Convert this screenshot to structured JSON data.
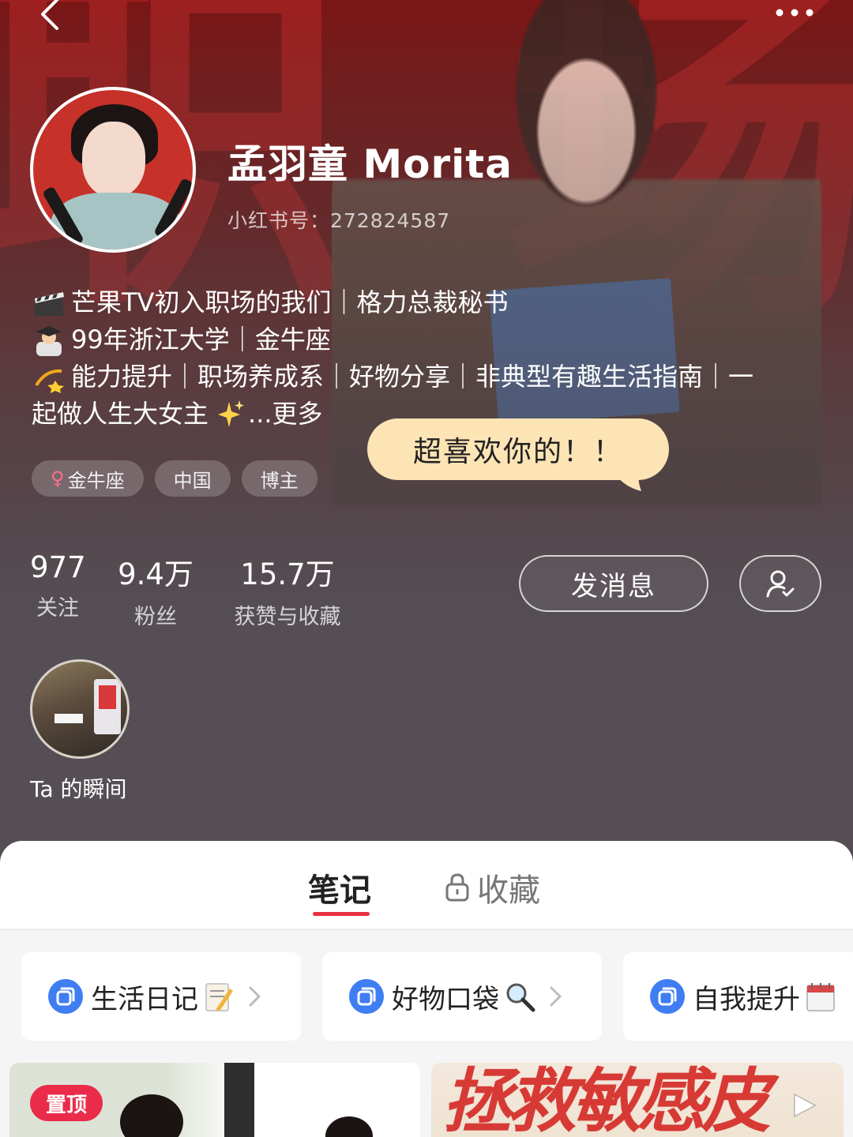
{
  "profile": {
    "name": "孟羽童 Morita",
    "red_id": "小红书号：272824587"
  },
  "bio": {
    "line1": "芒果TV初入职场的我们｜格力总裁秘书",
    "line2": "99年浙江大学｜金牛座",
    "line3": " 能力提升｜职场养成系｜好物分享｜非典型有趣生活指南｜一",
    "line4": "起做人生大女主",
    "more": "...更多",
    "emojis": [
      "clapper-board-icon",
      "student-icon",
      "dizzy-icon",
      "sparkles-icon"
    ]
  },
  "tags": {
    "zodiac": "金牛座",
    "region": "中国",
    "role": "博主"
  },
  "bubble": {
    "text": "超喜欢你的！！"
  },
  "stats": {
    "following": {
      "value": "977",
      "label": "关注"
    },
    "followers": {
      "value": "9.4万",
      "label": "粉丝"
    },
    "likes": {
      "value": "15.7万",
      "label": "获赞与收藏"
    }
  },
  "actions": {
    "message_label": "发消息",
    "follow_icon": "user-add-icon"
  },
  "moments": {
    "label": "Ta 的瞬间"
  },
  "tabs": {
    "notes_label": "笔记",
    "collect_label": "收藏"
  },
  "albums": [
    {
      "title": "生活日记",
      "emoji": "memo-icon"
    },
    {
      "title": "好物口袋",
      "emoji": "magnifier-icon"
    },
    {
      "title": "自我提升",
      "emoji": "calendar-icon"
    }
  ],
  "cards": {
    "pinned_badge": "置顶",
    "card2_text": "拯救敏感皮"
  },
  "colors": {
    "accent": "#e8303e",
    "bubble_bg": "#fce4b5",
    "album_icon": "#3f7df3",
    "pin_badge": "#ea2c4a"
  }
}
